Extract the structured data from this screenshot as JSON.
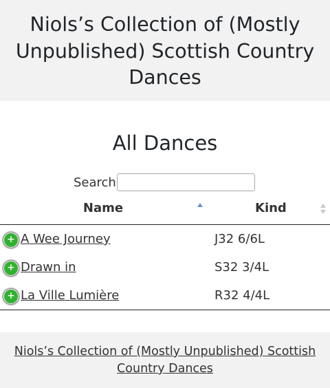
{
  "header": {
    "title": "Niols’s Collection of (Mostly Unpublished) Scottish Country Dances"
  },
  "page": {
    "title": "All Dances"
  },
  "search": {
    "label": "Search:",
    "value": "",
    "placeholder": ""
  },
  "table": {
    "columns": [
      {
        "label": "Name",
        "sort": "ascending"
      },
      {
        "label": "Kind",
        "sort": "none"
      }
    ],
    "rows": [
      {
        "expand_icon": "plus-circle-icon",
        "name": "A Wee Journey",
        "kind": "J32 6/6L"
      },
      {
        "expand_icon": "plus-circle-icon",
        "name": "Drawn in",
        "kind": "S32 3/4L"
      },
      {
        "expand_icon": "plus-circle-icon",
        "name": "La Ville Lumière",
        "kind": "R32 4/4L"
      }
    ],
    "expand_symbol": "+"
  },
  "footer": {
    "link": "Niols’s Collection of (Mostly Unpublished) Scottish Country Dances"
  },
  "colors": {
    "header_bg": "#f2f2f2",
    "expand_button": "#31b131",
    "sort_active": "#6c8fd4",
    "sort_inactive": "#c8c8c8"
  }
}
